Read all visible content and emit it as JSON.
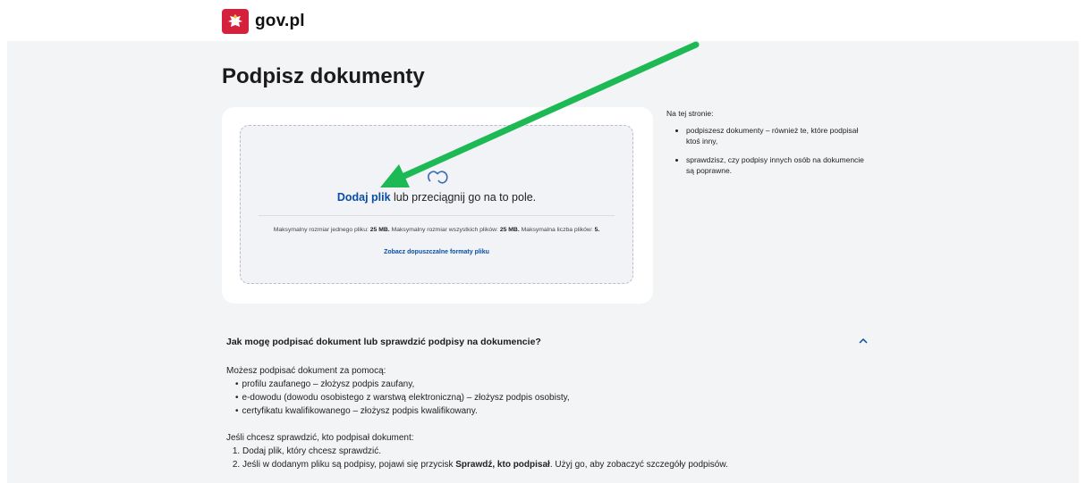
{
  "header": {
    "logo_text": "gov.pl"
  },
  "page": {
    "title": "Podpisz dokumenty"
  },
  "upload": {
    "add_link": "Dodaj plik",
    "drag_text": " lub przeciągnij go na to pole.",
    "limits": {
      "t1": "Maksymalny rozmiar jednego pliku: ",
      "v1": "25 MB.",
      "t2": " Maksymalny rozmiar wszystkich plików: ",
      "v2": "25 MB.",
      "t3": " Maksymalna liczba plików: ",
      "v3": "5."
    },
    "formats_link": "Zobacz dopuszczalne formaty pliku"
  },
  "aside": {
    "heading": "Na tej stronie:",
    "items": [
      "podpiszesz dokumenty – również te, które podpisał ktoś inny,",
      "sprawdzisz, czy podpisy innych osób na dokumencie są poprawne."
    ]
  },
  "faq": {
    "question": "Jak mogę podpisać dokument lub sprawdzić podpisy na dokumencie?",
    "intro": "Możesz podpisać dokument za pomocą:",
    "methods": [
      "profilu zaufanego – złożysz podpis zaufany,",
      "e-dowodu (dowodu osobistego z warstwą elektroniczną) – złożysz podpis osobisty,",
      "certyfikatu kwalifikowanego – złożysz podpis kwalifikowany."
    ],
    "check_intro": "Jeśli chcesz sprawdzić, kto podpisał dokument:",
    "step1": "Dodaj plik, który chcesz sprawdzić.",
    "step2_before": "Jeśli w dodanym pliku są podpisy, pojawi się przycisk ",
    "step2_button": "Sprawdź, kto podpisał",
    "step2_after": ". Użyj go, aby zobaczyć szczegóły podpisów."
  },
  "colors": {
    "link": "#0a4ea3",
    "arrow": "#1db954",
    "eagle_bg": "#d4213d"
  }
}
